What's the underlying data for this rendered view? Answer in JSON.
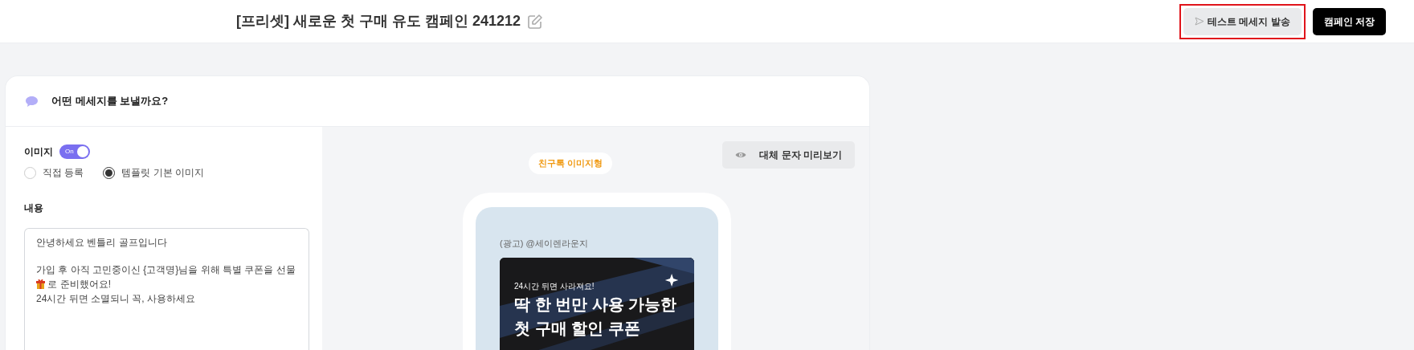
{
  "header": {
    "title": "[프리셋] 새로운 첫 구매 유도 캠페인 241212",
    "buttons": [
      {
        "label": "테스트 메세지 발송",
        "kind": "secondary",
        "highlighted": true
      },
      {
        "label": "캠페인 저장",
        "kind": "primary",
        "highlighted": false
      }
    ]
  },
  "card": {
    "title": "어떤 메세지를 보낼까요?",
    "image": {
      "label": "이미지",
      "toggle": {
        "text": "On",
        "on": true
      },
      "options": [
        {
          "label": "직접 등록",
          "selected": false
        },
        {
          "label": "템플릿 기본 이미지",
          "selected": true
        }
      ]
    },
    "content": {
      "label": "내용",
      "paragraphs": [
        {
          "lines": [
            {
              "text": "안녕하세요 벤틀리 골프입니다"
            }
          ]
        },
        {
          "lines": [
            {
              "text": "가입 후 아직 고민중이신 {고객명}님을 위해 특별 쿠폰을 선물",
              "text_after": "로 준비했어요!"
            },
            {
              "text": "24시간 뒤면 소멸되니 꼭, 사용하세요"
            }
          ]
        }
      ]
    },
    "preview": {
      "alt_button": "대체 문자 미리보기",
      "type_badge": "친구톡 이미지형",
      "sender": "(광고) @세이렌라운지",
      "banner": {
        "kicker": "24시간 뒤면 사라져요!",
        "headline": [
          "딱 한 번만 사용 가능한",
          "첫 구매 할인 쿠폰"
        ]
      }
    }
  }
}
